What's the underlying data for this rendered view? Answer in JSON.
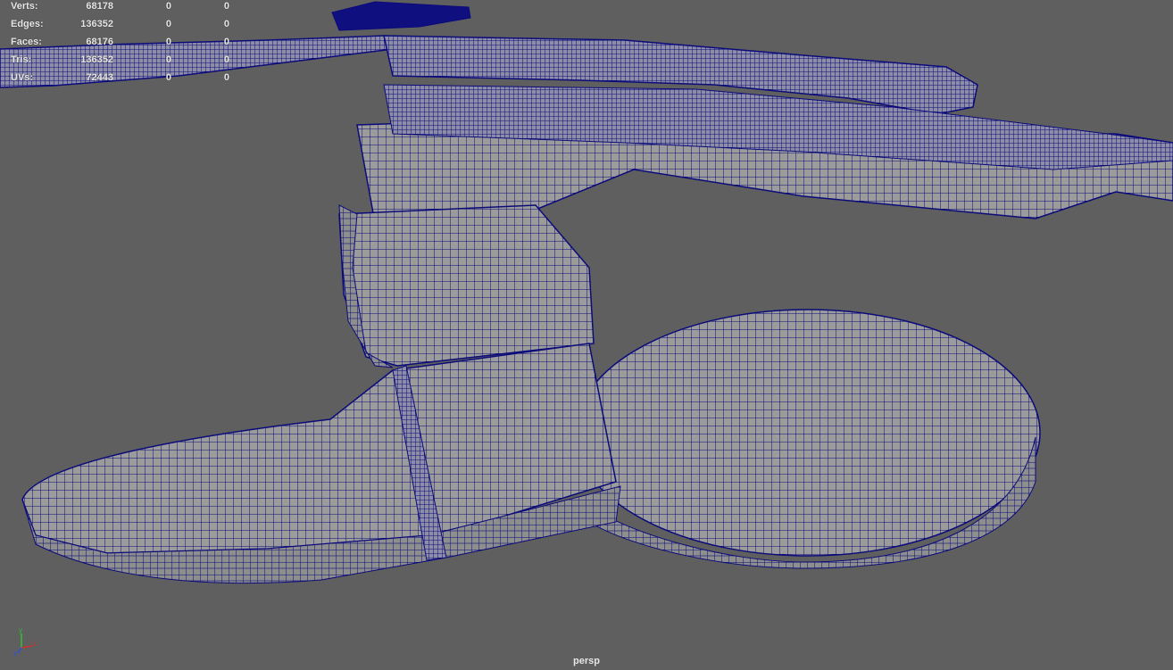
{
  "viewport": {
    "camera_name": "persp",
    "background_color": "#5f5f5f",
    "mesh_fill_color": "#9b9b9b",
    "wire_color": "#0b0b7a"
  },
  "hud": {
    "rows": [
      {
        "label": "Verts:",
        "total": "68178",
        "selected": "0",
        "components": "0"
      },
      {
        "label": "Edges:",
        "total": "136352",
        "selected": "0",
        "components": "0"
      },
      {
        "label": "Faces:",
        "total": "68176",
        "selected": "0",
        "components": "0"
      },
      {
        "label": "Tris:",
        "total": "136352",
        "selected": "0",
        "components": "0"
      },
      {
        "label": "UVs:",
        "total": "72443",
        "selected": "0",
        "components": "0"
      }
    ]
  },
  "axis_gizmo": {
    "x_label": "x",
    "y_label": "y",
    "z_label": "z",
    "x_color": "#d23030",
    "y_color": "#30c030",
    "z_color": "#3050e0"
  }
}
